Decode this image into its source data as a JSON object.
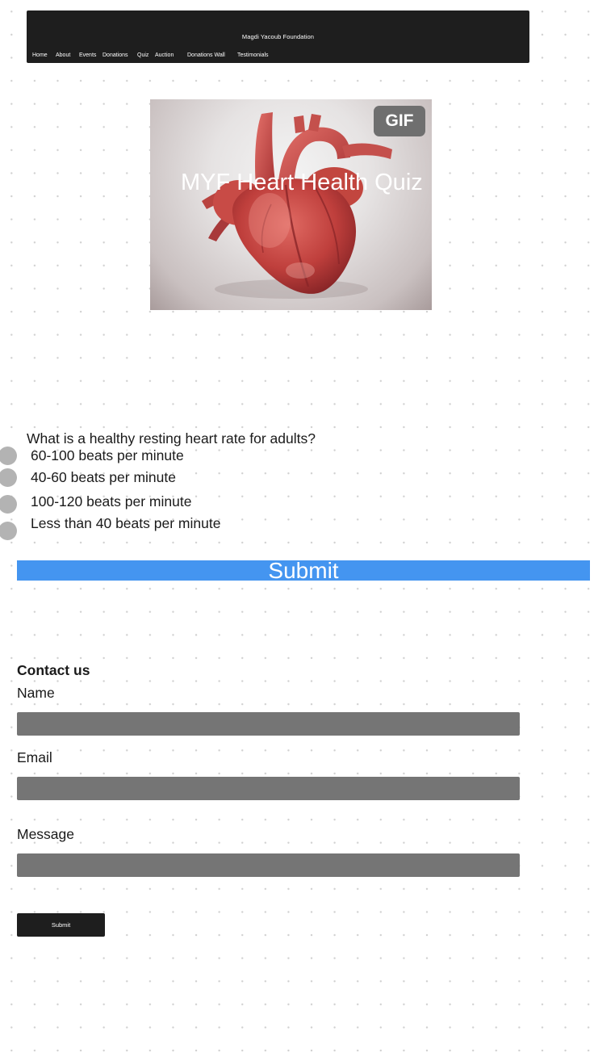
{
  "nav": {
    "brand": "Magdi Yacoub Foundation",
    "links": [
      "Home",
      "About",
      "Events",
      "Donations",
      "Quiz",
      "Auction",
      "Donations Wall",
      "Testimonials"
    ]
  },
  "hero": {
    "badge": "GIF",
    "title": "MYF Heart Health Quiz",
    "image_subject": "anatomical-heart"
  },
  "quiz": {
    "question": "What is a healthy resting heart rate for adults?",
    "options": [
      "60-100 beats per minute",
      "40-60 beats per minute",
      "100-120 beats per minute",
      "Less than 40 beats per minute"
    ],
    "submit_label": "Submit"
  },
  "contact": {
    "title": "Contact us",
    "name_label": "Name",
    "name_value": "",
    "email_label": "Email",
    "email_value": "",
    "message_label": "Message",
    "message_value": "",
    "submit_label": "Submit"
  },
  "colors": {
    "nav_bg": "#1e1e1e",
    "accent_blue": "#4495f0",
    "input_bg": "#757575",
    "radio": "#b3b3b3",
    "heart_red": "#b93a3a"
  }
}
